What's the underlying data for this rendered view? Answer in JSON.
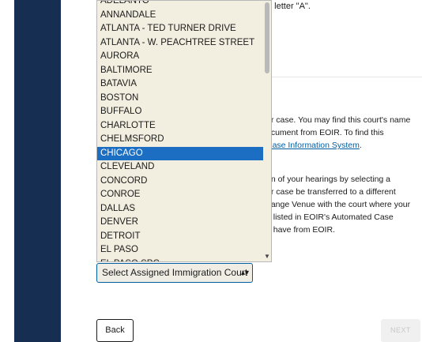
{
  "top_text": "e letter \"A\".",
  "paragraph1": {
    "line1": "ur case. You may find this court's name",
    "line2": "ocument from EOIR. To find this",
    "link": "Case Information System",
    "line3_suffix": "."
  },
  "paragraph2": {
    "lines": [
      "on of your hearings by selecting a",
      "ur case be transferred to a different",
      "hange Venue with the court where your",
      "e listed in EOIR's Automated Case",
      "u have from EOIR."
    ]
  },
  "court_select": {
    "value": "Select Assigned Immigration Court",
    "options": [
      "ADELANTO",
      "ANNANDALE",
      "ATLANTA - TED TURNER DRIVE",
      "ATLANTA - W. PEACHTREE STREET",
      "AURORA",
      "BALTIMORE",
      "BATAVIA",
      "BOSTON",
      "BUFFALO",
      "CHARLOTTE",
      "CHELMSFORD",
      "CHICAGO",
      "CLEVELAND",
      "CONCORD",
      "CONROE",
      "DALLAS",
      "DENVER",
      "DETROIT",
      "EL PASO",
      "EL PASO SPC"
    ],
    "highlighted": "CHICAGO"
  },
  "buttons": {
    "back": "Back",
    "next": "NEXT"
  },
  "colors": {
    "navy": "#162e51",
    "highlight": "#1b6ec2",
    "link": "#005ea2"
  }
}
